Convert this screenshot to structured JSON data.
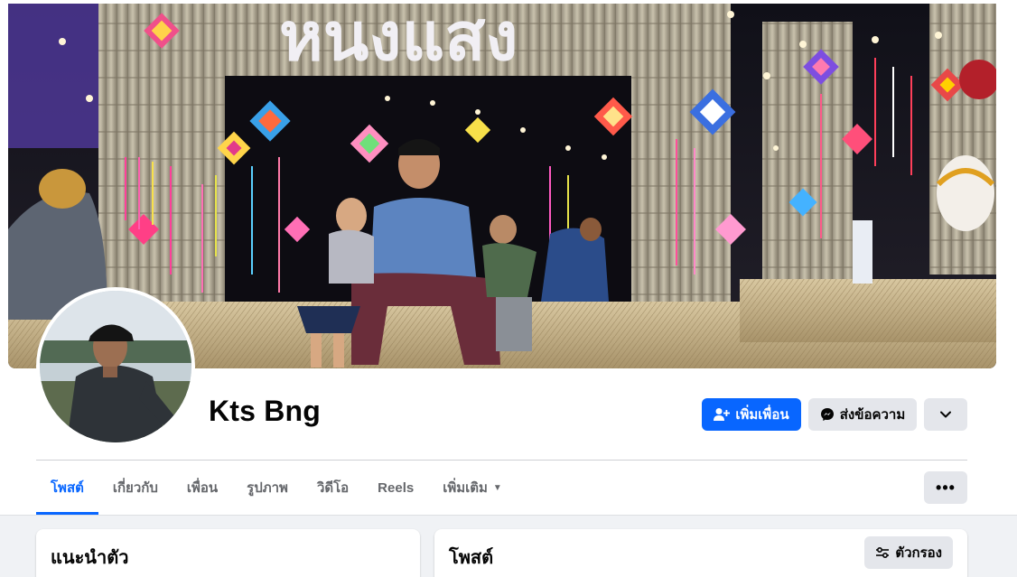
{
  "profile": {
    "name": "Kts Bng",
    "cover_text": "หนงแสง"
  },
  "actions": {
    "add_friend_label": "เพิ่มเพื่อน",
    "message_label": "ส่งข้อความ",
    "add_friend_icon": "person-plus-icon",
    "message_icon": "messenger-icon",
    "more_icon": "chevron-down-icon"
  },
  "tabs": [
    {
      "label": "โพสต์",
      "active": true
    },
    {
      "label": "เกี่ยวกับ",
      "active": false
    },
    {
      "label": "เพื่อน",
      "active": false
    },
    {
      "label": "รูปภาพ",
      "active": false
    },
    {
      "label": "วิดีโอ",
      "active": false
    },
    {
      "label": "Reels",
      "active": false
    },
    {
      "label": "เพิ่มเติม",
      "active": false
    }
  ],
  "tab_more_icon": "ellipsis-icon",
  "intro": {
    "title": "แนะนำตัว"
  },
  "posts": {
    "title": "โพสต์",
    "filter_label": "ตัวกรอง",
    "filter_icon": "sliders-icon"
  },
  "colors": {
    "accent": "#0866ff",
    "button_gray": "#e4e6eb",
    "feed_bg": "#f0f2f5",
    "muted_text": "#65676b"
  }
}
